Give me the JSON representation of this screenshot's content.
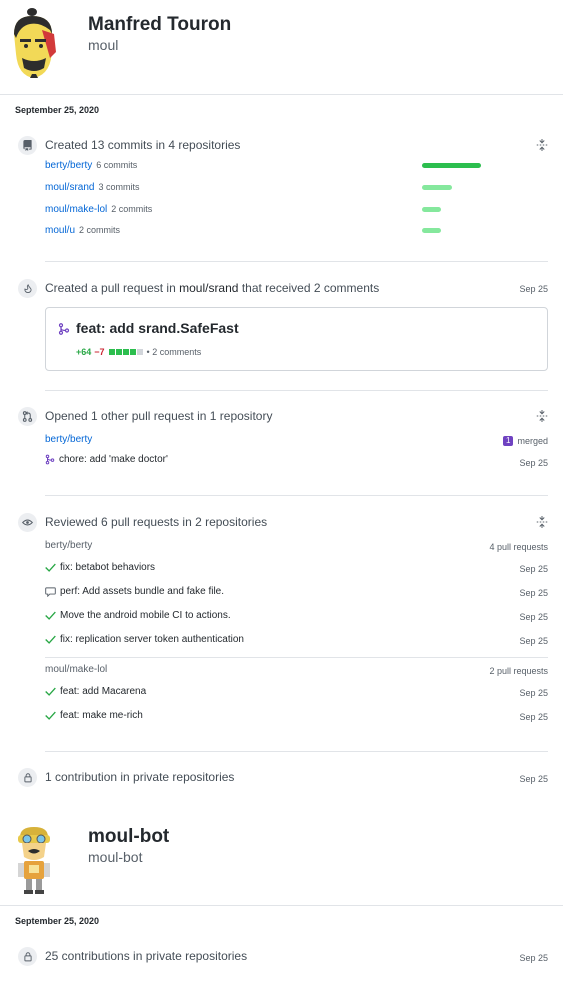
{
  "users": [
    {
      "name": "Manfred Touron",
      "login": "moul",
      "date": "September 25, 2020"
    },
    {
      "name": "moul-bot",
      "login": "moul-bot",
      "date": "September 25, 2020"
    }
  ],
  "commits": {
    "heading": "Created 13 commits in 4 repositories",
    "repos": [
      {
        "name": "berty/berty",
        "count": "6 commits",
        "fraction": 1.0,
        "color": "#2cbe4e"
      },
      {
        "name": "moul/srand",
        "count": "3 commits",
        "fraction": 0.5,
        "color": "#85e89d"
      },
      {
        "name": "moul/make-lol",
        "count": "2 commits",
        "fraction": 0.33,
        "color": "#85e89d"
      },
      {
        "name": "moul/u",
        "count": "2 commits",
        "fraction": 0.33,
        "color": "#85e89d"
      }
    ]
  },
  "pr_created": {
    "prefix": "Created a pull request in",
    "repo": "moul/srand",
    "suffix": "that received 2 comments",
    "date": "Sep 25",
    "title": "feat: add srand.SafeFast",
    "additions": "+64",
    "deletions": "−7",
    "comments": "• 2 comments",
    "diff_squares": [
      "#2cbe4e",
      "#2cbe4e",
      "#2cbe4e",
      "#2cbe4e",
      "#d1d5da"
    ]
  },
  "pr_opened": {
    "heading": "Opened 1 other pull request in 1 repository",
    "repo": "berty/berty",
    "merged_count": "1",
    "merged_label": "merged",
    "item": {
      "title": "chore: add 'make doctor'",
      "date": "Sep 25"
    }
  },
  "reviewed": {
    "heading": "Reviewed 6 pull requests in 2 repositories",
    "groups": [
      {
        "repo": "berty/berty",
        "count": "4 pull requests",
        "items": [
          {
            "title": "fix: betabot behaviors",
            "date": "Sep 25",
            "icon": "check-icon"
          },
          {
            "title": "perf: Add assets bundle and fake file.",
            "date": "Sep 25",
            "icon": "comment-icon"
          },
          {
            "title": "Move the android mobile CI to actions.",
            "date": "Sep 25",
            "icon": "check-icon"
          },
          {
            "title": "fix: replication server token authentication",
            "date": "Sep 25",
            "icon": "check-icon"
          }
        ]
      },
      {
        "repo": "moul/make-lol",
        "count": "2 pull requests",
        "items": [
          {
            "title": "feat: add Macarena",
            "date": "Sep 25",
            "icon": "check-icon"
          },
          {
            "title": "feat: make me-rich",
            "date": "Sep 25",
            "icon": "check-icon"
          }
        ]
      }
    ]
  },
  "private1": {
    "text": "1 contribution in private repositories",
    "date": "Sep 25"
  },
  "private2": {
    "text": "25 contributions in private repositories",
    "date": "Sep 25"
  },
  "colors": {
    "link": "#0366d6",
    "green": "#28a745",
    "red": "#cb2431",
    "purple": "#6f42c1"
  }
}
